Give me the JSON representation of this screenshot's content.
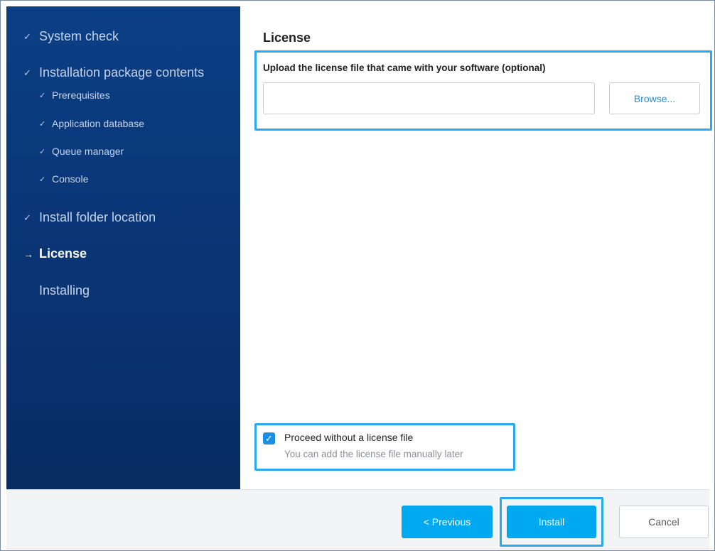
{
  "sidebar": {
    "steps": [
      {
        "label": "System check",
        "state": "done",
        "mark": "✓"
      },
      {
        "label": "Installation package contents",
        "state": "done",
        "mark": "✓"
      },
      {
        "label": "Prerequisites",
        "state": "done",
        "mark": "✓"
      },
      {
        "label": "Application database",
        "state": "done",
        "mark": "✓"
      },
      {
        "label": "Queue manager",
        "state": "done",
        "mark": "✓"
      },
      {
        "label": "Console",
        "state": "done",
        "mark": "✓"
      },
      {
        "label": "Install folder location",
        "state": "done",
        "mark": "✓"
      },
      {
        "label": "License",
        "state": "current",
        "mark": "→"
      },
      {
        "label": "Installing",
        "state": "pending",
        "mark": ""
      }
    ]
  },
  "license": {
    "title": "License",
    "upload_label": "Upload the license file that came with your software (optional)",
    "file_value": "",
    "browse_label": "Browse...",
    "proceed_checked": true,
    "proceed_check_glyph": "✓",
    "proceed_label": "Proceed without a license file",
    "proceed_hint": "You can add the license file manually later"
  },
  "footer": {
    "previous_label": "< Previous",
    "install_label": "Install",
    "cancel_label": "Cancel"
  },
  "colors": {
    "sidebar_bg": "#0a3677",
    "highlight": "#29aaf0",
    "primary_button": "#00a9f0",
    "checkbox": "#1a8fe3",
    "link_text": "#1a8fd6"
  },
  "icons": {
    "done": "checkmark-icon",
    "current": "arrow-right-icon"
  }
}
